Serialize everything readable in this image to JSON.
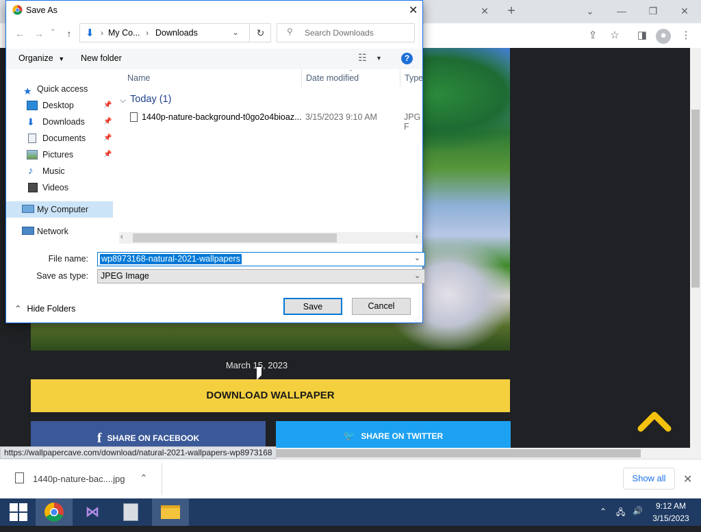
{
  "dialog": {
    "title": "Save As",
    "breadcrumb": [
      "My Co...",
      "Downloads"
    ],
    "search_placeholder": "Search Downloads",
    "organize_label": "Organize",
    "new_folder_label": "New folder",
    "nav": {
      "quick_access": "Quick access",
      "items": [
        {
          "label": "Desktop",
          "icon": "desktop-icon",
          "pinned": true
        },
        {
          "label": "Downloads",
          "icon": "downloads-icon",
          "pinned": true
        },
        {
          "label": "Documents",
          "icon": "documents-icon",
          "pinned": true
        },
        {
          "label": "Pictures",
          "icon": "pictures-icon",
          "pinned": true
        },
        {
          "label": "Music",
          "icon": "music-icon",
          "pinned": false
        },
        {
          "label": "Videos",
          "icon": "videos-icon",
          "pinned": false
        }
      ],
      "my_computer": "My Computer",
      "network": "Network"
    },
    "columns": [
      "Name",
      "Date modified",
      "Type"
    ],
    "group_label": "Today (1)",
    "files": [
      {
        "name": "1440p-nature-background-t0go2o4bioaz...",
        "date": "3/15/2023 9:10 AM",
        "type": "JPG F"
      }
    ],
    "file_name_label": "File name:",
    "file_name_value": "wp8973168-natural-2021-wallpapers",
    "save_as_type_label": "Save as type:",
    "save_as_type_value": "JPEG Image",
    "hide_folders_label": "Hide Folders",
    "save_button": "Save",
    "cancel_button": "Cancel",
    "help_glyph": "?"
  },
  "page": {
    "date": "March 15, 2023",
    "download_button": "DOWNLOAD WALLPAPER",
    "facebook_button": "SHARE ON FACEBOOK",
    "twitter_button": "SHARE ON TWITTER",
    "status_url": "https://wallpapercave.com/download/natural-2021-wallpapers-wp8973168"
  },
  "download_bar": {
    "file_name": "1440p-nature-bac....jpg",
    "show_all_label": "Show all"
  },
  "taskbar": {
    "time": "9:12 AM",
    "date": "3/15/2023"
  },
  "colors": {
    "accent": "#0078d7",
    "download_button": "#f4d03f",
    "facebook": "#3b5998",
    "twitter": "#1da1f2",
    "taskbar": "#1f3b64"
  }
}
